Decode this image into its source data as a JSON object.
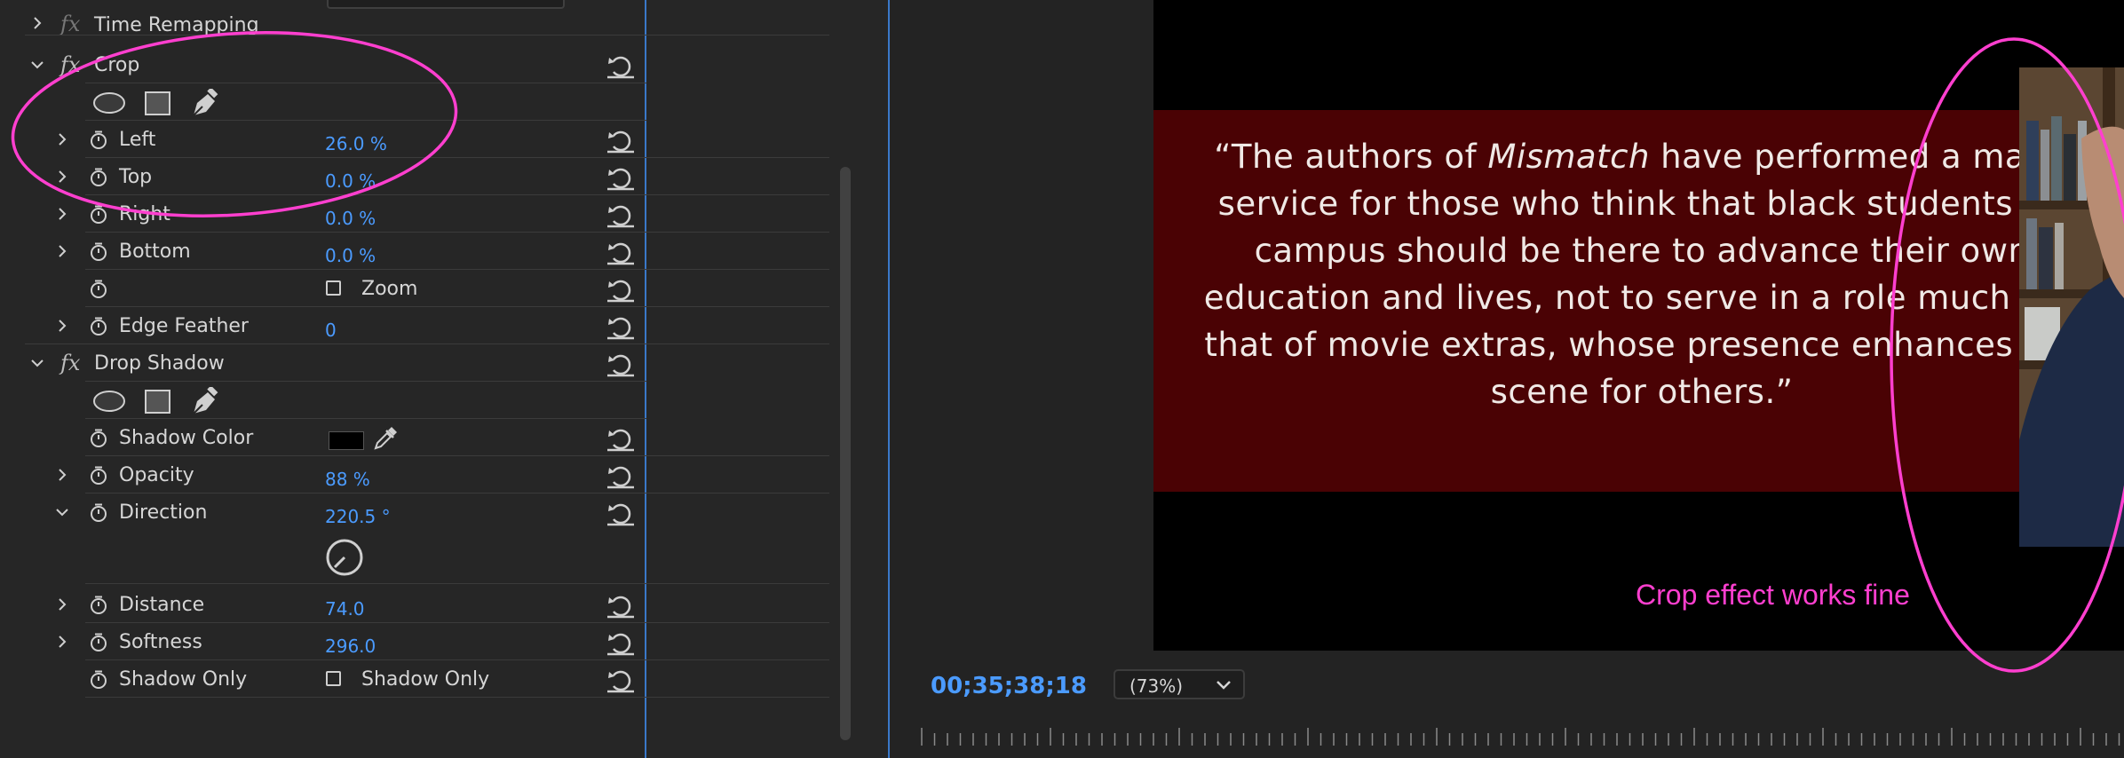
{
  "effects": {
    "time_remapping": {
      "label": "Time Remapping"
    },
    "crop": {
      "label": "Crop",
      "params": [
        {
          "label": "Left",
          "value": "26.0 %"
        },
        {
          "label": "Top",
          "value": "0.0 %"
        },
        {
          "label": "Right",
          "value": "0.0 %"
        },
        {
          "label": "Bottom",
          "value": "0.0 %"
        }
      ],
      "zoom_label": "Zoom",
      "zoom_checked": false,
      "edge_feather": {
        "label": "Edge Feather",
        "value": "0"
      }
    },
    "drop_shadow": {
      "label": "Drop Shadow",
      "shadow_color": {
        "label": "Shadow Color",
        "value": "#000000"
      },
      "opacity": {
        "label": "Opacity",
        "value": "88 %"
      },
      "direction": {
        "label": "Direction",
        "value": "220.5 °"
      },
      "distance": {
        "label": "Distance",
        "value": "74.0"
      },
      "softness": {
        "label": "Softness",
        "value": "296.0"
      },
      "shadow_only": {
        "label": "Shadow Only",
        "checkbox_label": "Shadow Only",
        "checked": false
      }
    }
  },
  "program": {
    "quote": {
      "before_italic": "“The authors of ",
      "italic": "Mismatch",
      "after_italic": " have performed a major service for those who think that black students on campus should be there to advance their own education and lives, not to serve in a role much like that of movie extras, whose presence enhances the scene for others.”"
    },
    "annotation": "Crop effect works fine",
    "timecode": "00;35;38;18",
    "zoom_level": "(73%)"
  },
  "colors": {
    "accent_blue": "#4b9bff",
    "annotation_magenta": "#ff3fcf",
    "quote_background": "#4a0204"
  },
  "icons": [
    "chevron-right-icon",
    "chevron-down-icon",
    "fx-icon",
    "stopwatch-icon",
    "reset-icon",
    "ellipse-mask-icon",
    "rectangle-mask-icon",
    "pen-mask-icon",
    "eyedropper-icon",
    "direction-dial-icon"
  ]
}
